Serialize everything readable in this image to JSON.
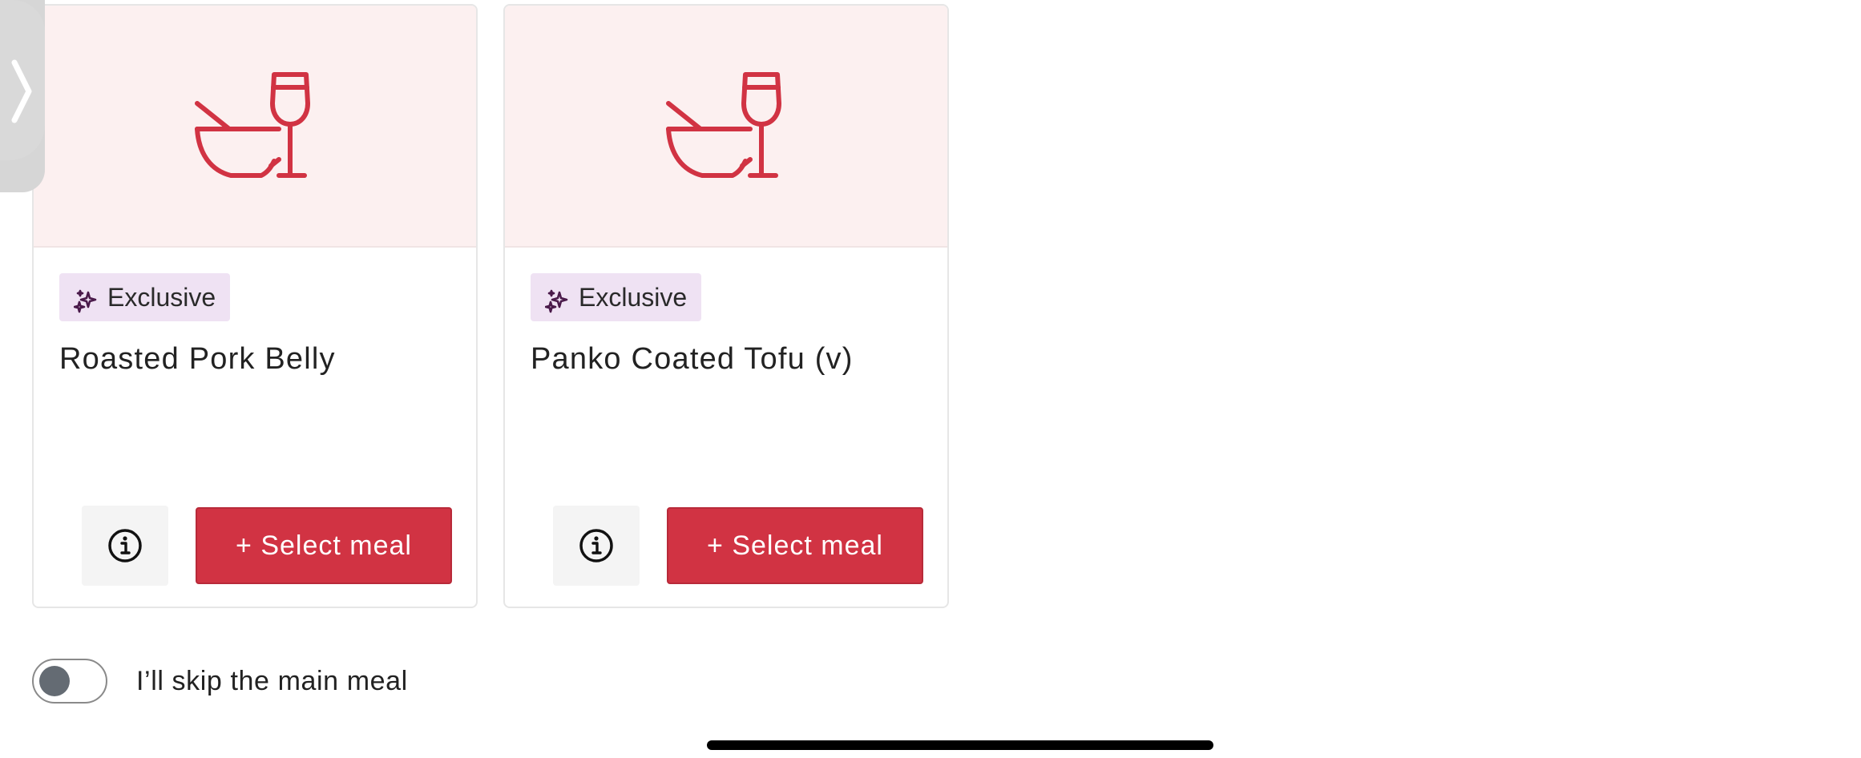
{
  "side_panel": {
    "icon": "chevron-right-icon"
  },
  "meals": [
    {
      "image_icon": "bowl-and-wine-glass-icon",
      "badge": {
        "icon": "sparkles-icon",
        "label": "Exclusive"
      },
      "name": "Roasted Pork Belly",
      "info_icon": "info-icon",
      "select_label": "+ Select meal"
    },
    {
      "image_icon": "bowl-and-wine-glass-icon",
      "badge": {
        "icon": "sparkles-icon",
        "label": "Exclusive"
      },
      "name": "Panko Coated Tofu (v)",
      "info_icon": "info-icon",
      "select_label": "+ Select meal"
    }
  ],
  "skip": {
    "label": "I’ll skip the main meal",
    "toggle_on": false
  },
  "colors": {
    "accent": "#d13343",
    "image_bg": "#fcf0f0",
    "badge_bg": "#efe2f3",
    "badge_icon": "#4a1a4a",
    "toggle_knob": "#646b73"
  }
}
